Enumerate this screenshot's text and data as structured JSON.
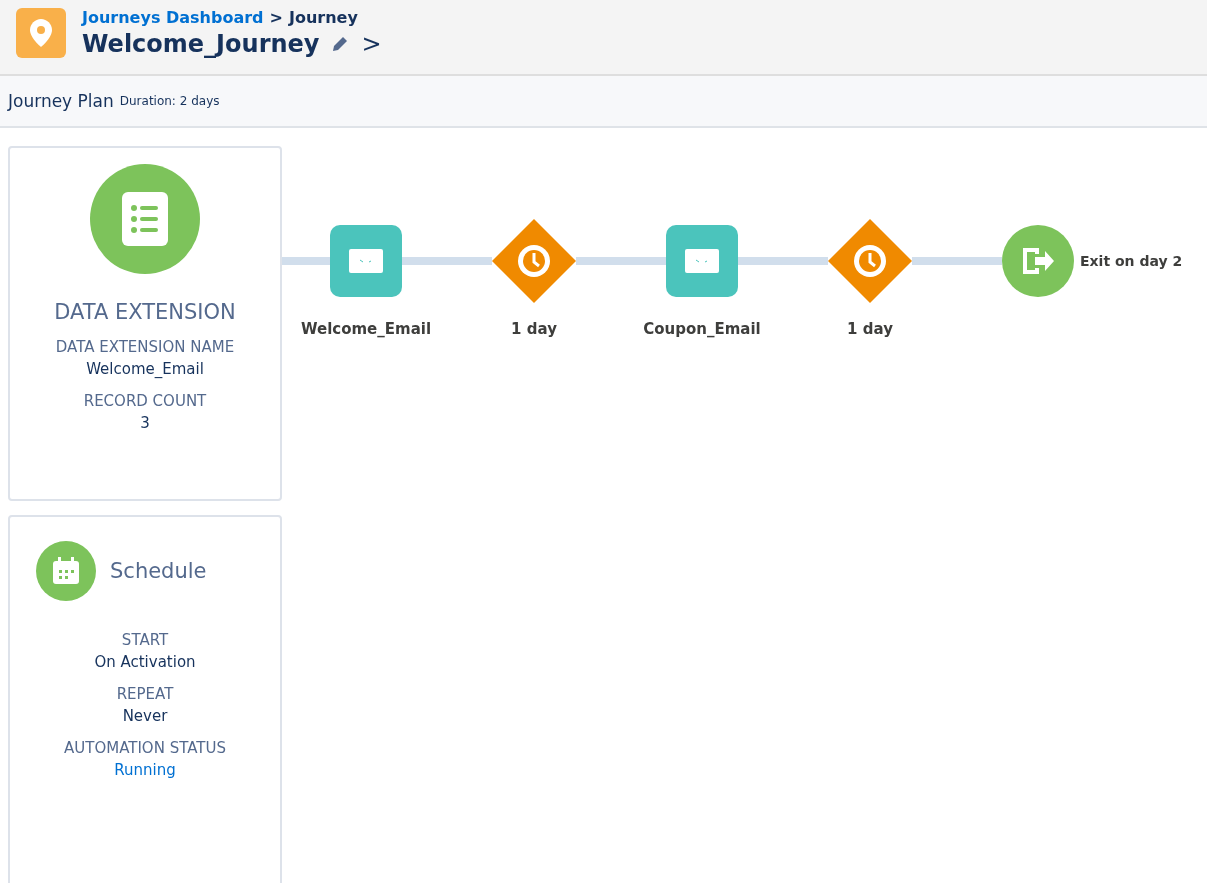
{
  "header": {
    "breadcrumb": [
      {
        "label": "Journeys Dashboard",
        "kind": "link"
      },
      {
        "label": ">",
        "kind": "separator"
      },
      {
        "label": "Journey",
        "kind": "text"
      }
    ],
    "title": "Welcome_Journey",
    "next": ">"
  },
  "plan_bar": {
    "title": "Journey Plan",
    "duration": "Duration: 2 days"
  },
  "data_extension_card": {
    "title": "DATA EXTENSION",
    "fields": [
      {
        "label": "DATA EXTENSION NAME",
        "value": "Welcome_Email"
      },
      {
        "label": "RECORD COUNT",
        "value": "3"
      }
    ]
  },
  "schedule_card": {
    "title": "Schedule",
    "fields": [
      {
        "label": "START",
        "value": "On Activation",
        "kind": "text"
      },
      {
        "label": "REPEAT",
        "value": "Never",
        "kind": "text"
      },
      {
        "label": "AUTOMATION STATUS",
        "value": "Running",
        "kind": "link"
      }
    ]
  },
  "journey_nodes": [
    {
      "kind": "email",
      "label": "Welcome_Email"
    },
    {
      "kind": "wait",
      "label": "1 day"
    },
    {
      "kind": "email",
      "label": "Coupon_Email"
    },
    {
      "kind": "wait",
      "label": "1 day"
    },
    {
      "kind": "exit",
      "label": "Exit on day 2"
    }
  ]
}
